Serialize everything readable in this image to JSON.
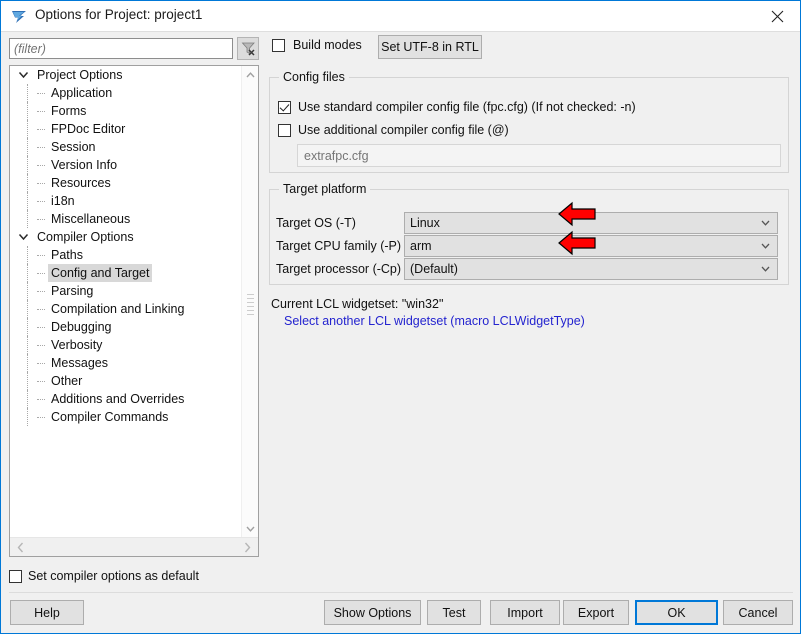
{
  "window": {
    "title": "Options for Project: project1",
    "app_icon": "lazarus-logo-icon",
    "close_label": "×"
  },
  "toolbar": {
    "filter_placeholder": "(filter)",
    "filter_value": "",
    "clear_filter_icon": "filter-clear-icon",
    "build_modes_label": "Build modes",
    "build_modes_checked": false,
    "utf8_button_label": "Set UTF-8 in RTL"
  },
  "tree": {
    "nodes": [
      {
        "label": "Project Options",
        "level": 0,
        "expanded": true,
        "selected": false
      },
      {
        "label": "Application",
        "level": 1,
        "expanded": null,
        "selected": false
      },
      {
        "label": "Forms",
        "level": 1,
        "expanded": null,
        "selected": false
      },
      {
        "label": "FPDoc Editor",
        "level": 1,
        "expanded": null,
        "selected": false
      },
      {
        "label": "Session",
        "level": 1,
        "expanded": null,
        "selected": false
      },
      {
        "label": "Version Info",
        "level": 1,
        "expanded": null,
        "selected": false
      },
      {
        "label": "Resources",
        "level": 1,
        "expanded": null,
        "selected": false
      },
      {
        "label": "i18n",
        "level": 1,
        "expanded": null,
        "selected": false
      },
      {
        "label": "Miscellaneous",
        "level": 1,
        "expanded": null,
        "selected": false
      },
      {
        "label": "Compiler Options",
        "level": 0,
        "expanded": true,
        "selected": false
      },
      {
        "label": "Paths",
        "level": 1,
        "expanded": null,
        "selected": false
      },
      {
        "label": "Config and Target",
        "level": 1,
        "expanded": null,
        "selected": true
      },
      {
        "label": "Parsing",
        "level": 1,
        "expanded": null,
        "selected": false
      },
      {
        "label": "Compilation and Linking",
        "level": 1,
        "expanded": null,
        "selected": false
      },
      {
        "label": "Debugging",
        "level": 1,
        "expanded": null,
        "selected": false
      },
      {
        "label": "Verbosity",
        "level": 1,
        "expanded": null,
        "selected": false
      },
      {
        "label": "Messages",
        "level": 1,
        "expanded": null,
        "selected": false
      },
      {
        "label": "Other",
        "level": 1,
        "expanded": null,
        "selected": false
      },
      {
        "label": "Additions and Overrides",
        "level": 1,
        "expanded": null,
        "selected": false
      },
      {
        "label": "Compiler Commands",
        "level": 1,
        "expanded": null,
        "selected": false
      }
    ]
  },
  "config_files": {
    "group_title": "Config files",
    "standard_label": "Use standard compiler config file (fpc.cfg) (If not checked: -n)",
    "standard_checked": true,
    "additional_label": "Use additional compiler config file (@)",
    "additional_checked": false,
    "extra_placeholder": "extrafpc.cfg",
    "extra_value": ""
  },
  "target_platform": {
    "group_title": "Target platform",
    "os_label": "Target OS (-T)",
    "os_value": "Linux",
    "cpu_label": "Target CPU family (-P)",
    "cpu_value": "arm",
    "processor_label": "Target processor (-Cp)",
    "processor_value": "(Default)"
  },
  "widgetset": {
    "current_line": "Current LCL widgetset: \"win32\"",
    "link_label": "Select another LCL widgetset (macro LCLWidgetType)",
    "link_color": "#2424cf"
  },
  "annotations": {
    "arrow_color": "#FF0000",
    "arrow_outline": "#000000",
    "arrow_os_target": "Target OS (-T) combo",
    "arrow_cpu_target": "Target CPU family (-P) combo"
  },
  "footer": {
    "set_default_label": "Set compiler options as default",
    "set_default_checked": false,
    "help_label": "Help",
    "show_options_label": "Show Options",
    "test_label": "Test",
    "import_label": "Import",
    "export_label": "Export",
    "ok_label": "OK",
    "cancel_label": "Cancel",
    "default_button": "OK",
    "focus_color": "#0078d7"
  }
}
